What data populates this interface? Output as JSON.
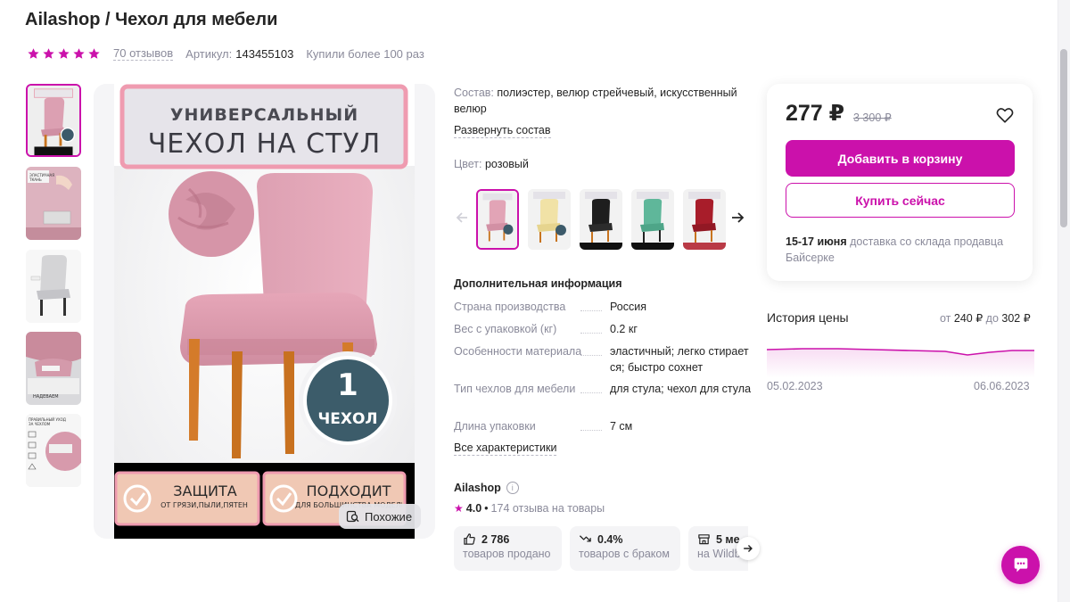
{
  "product": {
    "title": "Ailashop / Чехол для мебели",
    "rating_stars": 5,
    "reviews": "70 отзывов",
    "article_label": "Артикул:",
    "article_value": "143455103",
    "bought": "Купили более 100 раз"
  },
  "gallery": {
    "thumbnails": [
      {
        "name": "thumb-1",
        "active": true
      },
      {
        "name": "thumb-2",
        "caption": "ЭЛАСТИЧНАЯ ТКАНЬ"
      },
      {
        "name": "thumb-3"
      },
      {
        "name": "thumb-4",
        "caption": "НАДЕВАЕМ"
      },
      {
        "name": "thumb-5",
        "caption": "ПРАВИЛЬНЫЙ УХОД ЗА ЧЕХЛОМ"
      }
    ],
    "main_image": {
      "banner_line1": "УНИВЕРСАЛЬНЫЙ",
      "banner_line2": "ЧЕХОЛ НА СТУЛ",
      "badge_number": "1",
      "badge_word": "ЧЕХОЛ",
      "feature_left_title": "ЗАЩИТА",
      "feature_left_sub": "ОТ ГРЯЗИ,ПЫЛИ,ПЯТЕН",
      "feature_right_title": "ПОДХОДИТ",
      "feature_right_sub": "ДЛЯ БОЛЬШИНСТВА МОДЕЛЕЙ"
    },
    "similar_button": "Похожие"
  },
  "details": {
    "composition_label": "Состав:",
    "composition_value": "полиэстер, велюр стрейчевый, искусственный велюр",
    "expand_composition": "Развернуть состав",
    "color_label": "Цвет:",
    "color_value": "розовый",
    "swatches": [
      {
        "name": "pink",
        "color": "#e9a9bb",
        "active": true
      },
      {
        "name": "cream",
        "color": "#f1e2a6"
      },
      {
        "name": "black",
        "color": "#1e1e1e"
      },
      {
        "name": "mint",
        "color": "#5fb79a"
      },
      {
        "name": "burgundy",
        "color": "#a81d2a"
      }
    ],
    "additional_info_title": "Дополнительная информация",
    "specs": [
      {
        "key": "Страна производства",
        "value": "Россия"
      },
      {
        "key": "Вес с упаковкой (кг)",
        "value": "0.2 кг"
      },
      {
        "key": "Особенности материала",
        "value": "эластичный; легко стирается; быстро сохнет"
      },
      {
        "key": "Тип чехлов для мебели",
        "value": "для стула; чехол для стула"
      },
      {
        "key": "Длина упаковки",
        "value": "7 см"
      }
    ],
    "all_specs": "Все характеристики"
  },
  "seller": {
    "name": "Ailashop",
    "rating": "4.0",
    "separator": "•",
    "reviews": "174 отзыва на товары",
    "stats": [
      {
        "value": "2 786",
        "label": "товаров продано",
        "icon": "thumbs-up-icon"
      },
      {
        "value": "0.4%",
        "label": "товаров с браком",
        "icon": "trend-down-icon"
      },
      {
        "value": "5 ме",
        "label": "на Wildb",
        "icon": "store-icon"
      }
    ]
  },
  "buy": {
    "price": "277 ₽",
    "old_price": "3 300 ₽",
    "add_to_cart": "Добавить в корзину",
    "buy_now": "Купить сейчас",
    "delivery_date": "15-17 июня",
    "delivery_text": "доставка со склада продавца Байсерке"
  },
  "price_history": {
    "title": "История цены",
    "from_label": "от",
    "min": "240 ₽",
    "to_label": "до",
    "max": "302 ₽",
    "start_date": "05.02.2023",
    "end_date": "06.06.2023"
  },
  "colors": {
    "accent": "#cb11ab",
    "text": "#242424",
    "muted": "#8a8a9a"
  }
}
